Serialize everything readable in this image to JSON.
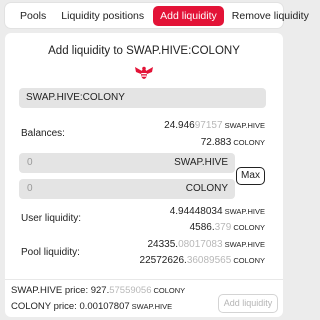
{
  "tabs": [
    {
      "label": "Pools"
    },
    {
      "label": "Liquidity positions"
    },
    {
      "label": "Add liquidity"
    },
    {
      "label": "Remove liquidity"
    }
  ],
  "accent_color": "#e31337",
  "title": "Add liquidity to SWAP.HIVE:COLONY",
  "logo_icon": "hive-bee-icon",
  "pair_field": {
    "value": "SWAP.HIVE:COLONY"
  },
  "balances": {
    "label": "Balances:",
    "base": {
      "main": "24.946",
      "dim": "97157",
      "unit": "SWAP.HIVE"
    },
    "quote": {
      "main": "72.883",
      "dim": "",
      "unit": "COLONY"
    }
  },
  "inputs": {
    "base": {
      "value": "0",
      "symbol": "SWAP.HIVE"
    },
    "quote": {
      "value": "0",
      "symbol": "COLONY"
    },
    "max_label": "Max"
  },
  "user_liquidity": {
    "label": "User liquidity:",
    "base": {
      "main": "4.94448034",
      "dim": "",
      "unit": "SWAP.HIVE"
    },
    "quote": {
      "main": "4586.",
      "dim": "379",
      "unit": "COLONY"
    }
  },
  "pool_liquidity": {
    "label": "Pool liquidity:",
    "base": {
      "main": "24335.",
      "dim": "08017083",
      "unit": "SWAP.HIVE"
    },
    "quote": {
      "main": "22572626.",
      "dim": "36089565",
      "unit": "COLONY"
    }
  },
  "prices": {
    "base": {
      "label": "SWAP.HIVE price:",
      "main": "927.",
      "dim": "57559056",
      "unit": "COLONY"
    },
    "quote": {
      "label": "COLONY price:",
      "main": "0.00107807",
      "dim": "",
      "unit": "SWAP.HIVE"
    }
  },
  "add_button_label": "Add liquidity"
}
